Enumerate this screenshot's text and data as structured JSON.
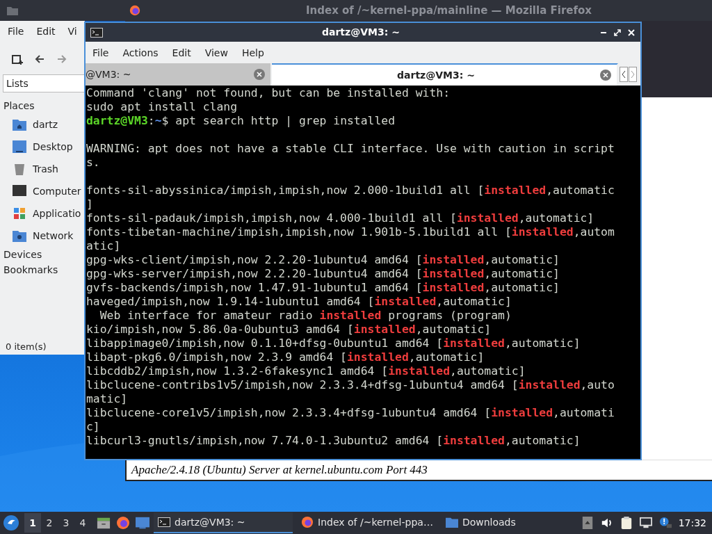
{
  "firefox_window": {
    "title": "Index of /~kernel-ppa/mainline — Mozilla Firefox",
    "footer": "Apache/2.4.18 (Ubuntu) Server at kernel.ubuntu.com Port 443"
  },
  "file_manager": {
    "menu": [
      "File",
      "Edit",
      "Vi"
    ],
    "location": "Lists",
    "sections": [
      {
        "title": "Places",
        "items": [
          {
            "label": "dartz",
            "kind": "home"
          },
          {
            "label": "Desktop",
            "kind": "desktop"
          },
          {
            "label": "Trash",
            "kind": "trash"
          },
          {
            "label": "Computer",
            "kind": "computer"
          },
          {
            "label": "Applicatio",
            "kind": "apps"
          },
          {
            "label": "Network",
            "kind": "network"
          }
        ]
      },
      {
        "title": "Devices"
      },
      {
        "title": "Bookmarks"
      }
    ],
    "status": "0 item(s)"
  },
  "terminal": {
    "title": "dartz@VM3: ~",
    "menu": [
      "File",
      "Actions",
      "Edit",
      "View",
      "Help"
    ],
    "tabs": [
      {
        "label": "@VM3: ~",
        "selected": false
      },
      {
        "label": "dartz@VM3: ~",
        "selected": true
      }
    ],
    "lines": [
      {
        "segments": [
          {
            "text": "Command 'clang' not found, but can be installed with:",
            "kind": "plain"
          }
        ]
      },
      {
        "segments": [
          {
            "text": "sudo apt install clang",
            "kind": "plain"
          }
        ]
      },
      {
        "segments": [
          {
            "text": "dartz@VM3",
            "kind": "user"
          },
          {
            "text": ":",
            "kind": "plain"
          },
          {
            "text": "~",
            "kind": "path"
          },
          {
            "text": "$ apt search http | grep installed",
            "kind": "plain"
          }
        ]
      },
      {
        "kind": "blank"
      },
      {
        "segments": [
          {
            "text": "WARNING: apt does not have a stable CLI interface. Use with caution in script",
            "kind": "plain"
          }
        ]
      },
      {
        "segments": [
          {
            "text": "s.",
            "kind": "plain"
          }
        ]
      },
      {
        "kind": "blank"
      },
      {
        "segments": [
          {
            "text": "fonts-sil-abyssinica/impish,impish,now 2.000-1build1 all [",
            "kind": "plain"
          },
          {
            "text": "installed",
            "kind": "match"
          },
          {
            "text": ",automatic",
            "kind": "plain"
          }
        ]
      },
      {
        "segments": [
          {
            "text": "]",
            "kind": "plain"
          }
        ]
      },
      {
        "segments": [
          {
            "text": "fonts-sil-padauk/impish,impish,now 4.000-1build1 all [",
            "kind": "plain"
          },
          {
            "text": "installed",
            "kind": "match"
          },
          {
            "text": ",automatic]",
            "kind": "plain"
          }
        ]
      },
      {
        "segments": [
          {
            "text": "fonts-tibetan-machine/impish,impish,now 1.901b-5.1build1 all [",
            "kind": "plain"
          },
          {
            "text": "installed",
            "kind": "match"
          },
          {
            "text": ",autom",
            "kind": "plain"
          }
        ]
      },
      {
        "segments": [
          {
            "text": "atic]",
            "kind": "plain"
          }
        ]
      },
      {
        "segments": [
          {
            "text": "gpg-wks-client/impish,now 2.2.20-1ubuntu4 amd64 [",
            "kind": "plain"
          },
          {
            "text": "installed",
            "kind": "match"
          },
          {
            "text": ",automatic]",
            "kind": "plain"
          }
        ]
      },
      {
        "segments": [
          {
            "text": "gpg-wks-server/impish,now 2.2.20-1ubuntu4 amd64 [",
            "kind": "plain"
          },
          {
            "text": "installed",
            "kind": "match"
          },
          {
            "text": ",automatic]",
            "kind": "plain"
          }
        ]
      },
      {
        "segments": [
          {
            "text": "gvfs-backends/impish,now 1.47.91-1ubuntu1 amd64 [",
            "kind": "plain"
          },
          {
            "text": "installed",
            "kind": "match"
          },
          {
            "text": ",automatic]",
            "kind": "plain"
          }
        ]
      },
      {
        "segments": [
          {
            "text": "haveged/impish,now 1.9.14-1ubuntu1 amd64 [",
            "kind": "plain"
          },
          {
            "text": "installed",
            "kind": "match"
          },
          {
            "text": ",automatic]",
            "kind": "plain"
          }
        ]
      },
      {
        "segments": [
          {
            "text": "  Web interface for amateur radio ",
            "kind": "plain"
          },
          {
            "text": "installed",
            "kind": "match"
          },
          {
            "text": " programs (program)",
            "kind": "plain"
          }
        ]
      },
      {
        "segments": [
          {
            "text": "kio/impish,now 5.86.0a-0ubuntu3 amd64 [",
            "kind": "plain"
          },
          {
            "text": "installed",
            "kind": "match"
          },
          {
            "text": ",automatic]",
            "kind": "plain"
          }
        ]
      },
      {
        "segments": [
          {
            "text": "libappimage0/impish,now 0.1.10+dfsg-0ubuntu1 amd64 [",
            "kind": "plain"
          },
          {
            "text": "installed",
            "kind": "match"
          },
          {
            "text": ",automatic]",
            "kind": "plain"
          }
        ]
      },
      {
        "segments": [
          {
            "text": "libapt-pkg6.0/impish,now 2.3.9 amd64 [",
            "kind": "plain"
          },
          {
            "text": "installed",
            "kind": "match"
          },
          {
            "text": ",automatic]",
            "kind": "plain"
          }
        ]
      },
      {
        "segments": [
          {
            "text": "libcddb2/impish,now 1.3.2-6fakesync1 amd64 [",
            "kind": "plain"
          },
          {
            "text": "installed",
            "kind": "match"
          },
          {
            "text": ",automatic]",
            "kind": "plain"
          }
        ]
      },
      {
        "segments": [
          {
            "text": "libclucene-contribs1v5/impish,now 2.3.3.4+dfsg-1ubuntu4 amd64 [",
            "kind": "plain"
          },
          {
            "text": "installed",
            "kind": "match"
          },
          {
            "text": ",auto",
            "kind": "plain"
          }
        ]
      },
      {
        "segments": [
          {
            "text": "matic]",
            "kind": "plain"
          }
        ]
      },
      {
        "segments": [
          {
            "text": "libclucene-core1v5/impish,now 2.3.3.4+dfsg-1ubuntu4 amd64 [",
            "kind": "plain"
          },
          {
            "text": "installed",
            "kind": "match"
          },
          {
            "text": ",automati",
            "kind": "plain"
          }
        ]
      },
      {
        "segments": [
          {
            "text": "c]",
            "kind": "plain"
          }
        ]
      },
      {
        "segments": [
          {
            "text": "libcurl3-gnutls/impish,now 7.74.0-1.3ubuntu2 amd64 [",
            "kind": "plain"
          },
          {
            "text": "installed",
            "kind": "match"
          },
          {
            "text": ",automatic]",
            "kind": "plain"
          }
        ]
      }
    ]
  },
  "taskbar": {
    "workspaces": [
      {
        "label": "1",
        "selected": true
      },
      {
        "label": "2",
        "selected": false
      },
      {
        "label": "3",
        "selected": false
      },
      {
        "label": "4",
        "selected": false
      }
    ],
    "tasks": [
      {
        "label": "dartz@VM3: ~",
        "kind": "terminal",
        "selected": true
      },
      {
        "label": "Index of /~kernel-ppa…",
        "kind": "browser",
        "selected": false
      },
      {
        "label": "Downloads",
        "kind": "folder",
        "selected": false
      }
    ],
    "clock": "17:32"
  }
}
